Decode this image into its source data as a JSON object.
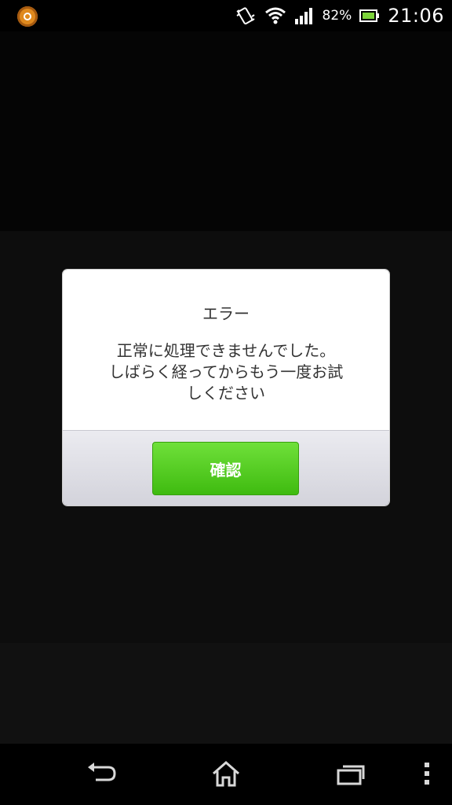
{
  "status_bar": {
    "battery_percent": "82%",
    "time": "21:06",
    "icons": [
      "app-notification-icon",
      "vibrate-icon",
      "wifi-icon",
      "signal-icon",
      "battery-icon"
    ]
  },
  "dialog": {
    "title": "エラー",
    "message": "正常に処理できませんでした。\nしばらく経ってからもう一度お試\nしください",
    "confirm_label": "確認",
    "accent_color": "#4ccb1e"
  },
  "nav_bar": {
    "icons": [
      "back-icon",
      "home-icon",
      "recent-apps-icon",
      "menu-icon"
    ]
  },
  "colors": {
    "background": "#000000",
    "overlay_band": "#0f0f0f",
    "dialog_background": "#ffffff",
    "footer_background": "#dcdce3",
    "button_green": "#4ccb1e"
  }
}
